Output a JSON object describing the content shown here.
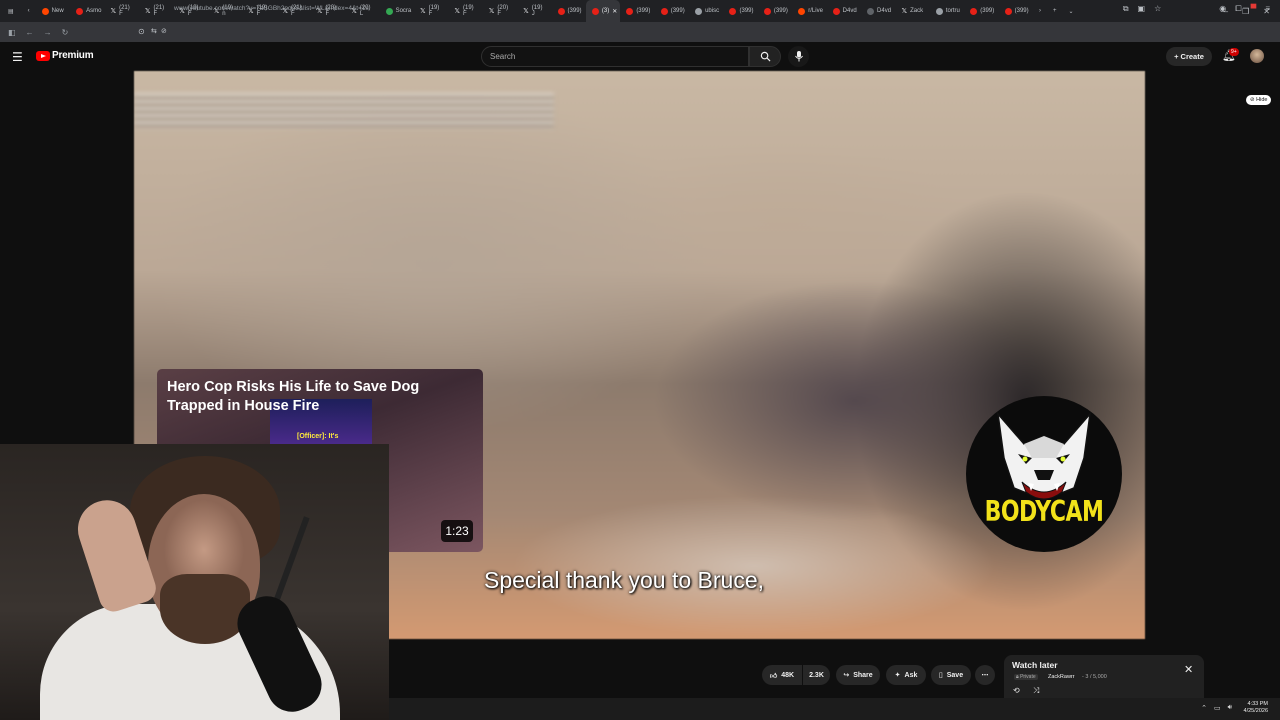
{
  "browser": {
    "tabs": [
      {
        "label": "New",
        "icon": "reddit-icon"
      },
      {
        "label": "Asmo",
        "icon": "asmongold-icon"
      },
      {
        "label": "(21) F",
        "icon": "x-icon"
      },
      {
        "label": "(21) F",
        "icon": "x-icon"
      },
      {
        "label": "(19) F",
        "icon": "x-icon"
      },
      {
        "label": "(19) n",
        "icon": "x-icon"
      },
      {
        "label": "(19) F",
        "icon": "x-icon"
      },
      {
        "label": "(21) F",
        "icon": "x-icon"
      },
      {
        "label": "(20) F",
        "icon": "x-icon"
      },
      {
        "label": "(20) L",
        "icon": "x-icon"
      },
      {
        "label": "Socra",
        "icon": "socra-icon"
      },
      {
        "label": "(19) F",
        "icon": "x-icon"
      },
      {
        "label": "(19) F",
        "icon": "x-icon"
      },
      {
        "label": "(20) F",
        "icon": "x-icon"
      },
      {
        "label": "(19) J",
        "icon": "x-icon"
      },
      {
        "label": "(399)",
        "icon": "youtube-icon"
      },
      {
        "label": "(3)",
        "icon": "youtube-icon",
        "active": true
      },
      {
        "label": "(399)",
        "icon": "youtube-icon"
      },
      {
        "label": "(399)",
        "icon": "youtube-icon"
      },
      {
        "label": "ubisc",
        "icon": "ubisoft-icon"
      },
      {
        "label": "(399)",
        "icon": "youtube-icon"
      },
      {
        "label": "(399)",
        "icon": "youtube-icon"
      },
      {
        "label": "r/Live",
        "icon": "reddit-icon"
      },
      {
        "label": "D4vd",
        "icon": "youtube-icon"
      },
      {
        "label": "D4vd",
        "icon": "page-icon"
      },
      {
        "label": "Zack",
        "icon": "x-icon"
      },
      {
        "label": "tortru",
        "icon": "web-icon"
      },
      {
        "label": "(399)",
        "icon": "youtube-icon"
      },
      {
        "label": "(399)",
        "icon": "youtube-icon"
      }
    ],
    "url": "www.youtube.com/watch?v=7aSGBh2pqo8&list=WL&index=4&t=1s"
  },
  "masthead": {
    "logo_text": "Premium",
    "search_placeholder": "Search",
    "create_label": "Create",
    "notif_badge": "9+"
  },
  "player": {
    "hide_label": "Hide",
    "caption": "Special thank you to Bruce,",
    "endcard_title": "Hero Cop Risks His Life to Save Dog Trapped in House Fire",
    "endcard_thumb_text": "[Officer]: It's",
    "endcard_duration": "1:23",
    "channel_logo_text": "BODYCAM"
  },
  "actions": {
    "likes": "48K",
    "dislike_count": "2.3K",
    "share_label": "Share",
    "ask_label": "Ask",
    "save_label": "Save"
  },
  "watch_later": {
    "title": "Watch later",
    "privacy": "Private",
    "owner": "ZackRawrr",
    "count": "- 3 / 5,000"
  },
  "taskbar": {
    "time": "4:33 PM",
    "date": "4/25/2026"
  },
  "colors": {
    "yt_red": "#ff0000",
    "background": "#0f0f0f",
    "bodycam_yellow": "#f2e21a"
  }
}
